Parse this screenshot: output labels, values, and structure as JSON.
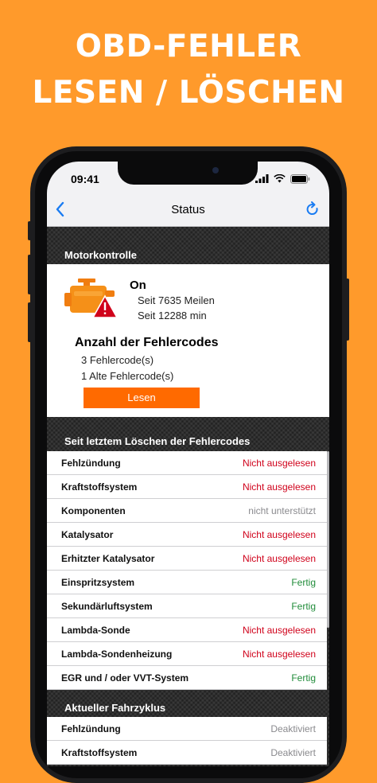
{
  "headline": {
    "line1": "OBD-FEHLER",
    "line2": "LESEN / LÖSCHEN"
  },
  "status_bar": {
    "time": "09:41"
  },
  "nav": {
    "title": "Status",
    "back_icon": "chevron-left-icon",
    "refresh_icon": "refresh-icon"
  },
  "motor": {
    "section_title": "Motorkontrolle",
    "status": "On",
    "since_miles": "Seit 7635 Meilen",
    "since_minutes": "Seit 12288 min",
    "codes_title": "Anzahl der Fehlercodes",
    "codes_current": "3 Fehlercode(s)",
    "codes_old": "1 Alte Fehlercode(s)",
    "read_button": "Lesen"
  },
  "since_clear": {
    "section_title": "Seit letztem Löschen der Fehlercodes",
    "rows": [
      {
        "label": "Fehlzündung",
        "value": "Nicht ausgelesen",
        "state": "red"
      },
      {
        "label": "Kraftstoffsystem",
        "value": "Nicht ausgelesen",
        "state": "red"
      },
      {
        "label": "Komponenten",
        "value": "nicht unterstützt",
        "state": "gray"
      },
      {
        "label": "Katalysator",
        "value": "Nicht ausgelesen",
        "state": "red"
      },
      {
        "label": "Erhitzter Katalysator",
        "value": "Nicht ausgelesen",
        "state": "red"
      },
      {
        "label": "Einspritzsystem",
        "value": "Fertig",
        "state": "green"
      },
      {
        "label": "Sekundärluftsystem",
        "value": "Fertig",
        "state": "green"
      },
      {
        "label": "Lambda-Sonde",
        "value": "Nicht ausgelesen",
        "state": "red"
      },
      {
        "label": "Lambda-Sondenheizung",
        "value": "Nicht ausgelesen",
        "state": "red"
      },
      {
        "label": "EGR und / oder VVT-System",
        "value": "Fertig",
        "state": "green"
      }
    ]
  },
  "current_cycle": {
    "section_title": "Aktueller Fahrzyklus",
    "rows": [
      {
        "label": "Fehlzündung",
        "value": "Deaktiviert",
        "state": "gray"
      },
      {
        "label": "Kraftstoffsystem",
        "value": "Deaktiviert",
        "state": "gray"
      }
    ]
  },
  "colors": {
    "background": "#FF9A2B",
    "accent": "#FF6A00",
    "ios_blue": "#1a7cf2",
    "red": "#d0021b",
    "green": "#218c3a"
  }
}
